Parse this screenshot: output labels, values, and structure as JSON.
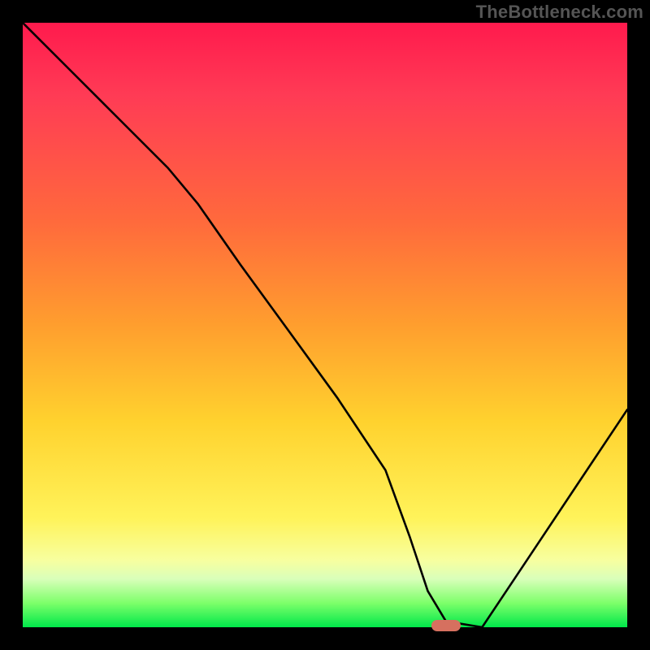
{
  "watermark": "TheBottleneck.com",
  "chart_data": {
    "type": "line",
    "title": "",
    "xlabel": "",
    "ylabel": "",
    "xlim": [
      0,
      100
    ],
    "ylim": [
      0,
      100
    ],
    "grid": false,
    "legend": false,
    "series": [
      {
        "name": "curve",
        "x": [
          0,
          8,
          16,
          24,
          29,
          36,
          44,
          52,
          60,
          64,
          67,
          70,
          76,
          84,
          92,
          100
        ],
        "values": [
          100,
          92,
          84,
          76,
          70,
          60,
          49,
          38,
          26,
          15,
          6,
          1,
          0,
          12,
          24,
          36
        ]
      }
    ],
    "marker": {
      "x": 70,
      "y": 0,
      "color": "#d6705f"
    },
    "gradient_stops": [
      {
        "t": 0.0,
        "color": "#ff1a4d"
      },
      {
        "t": 0.33,
        "color": "#ff6a3c"
      },
      {
        "t": 0.66,
        "color": "#ffd22e"
      },
      {
        "t": 0.9,
        "color": "#f7ffa0"
      },
      {
        "t": 1.0,
        "color": "#00e84a"
      }
    ]
  }
}
